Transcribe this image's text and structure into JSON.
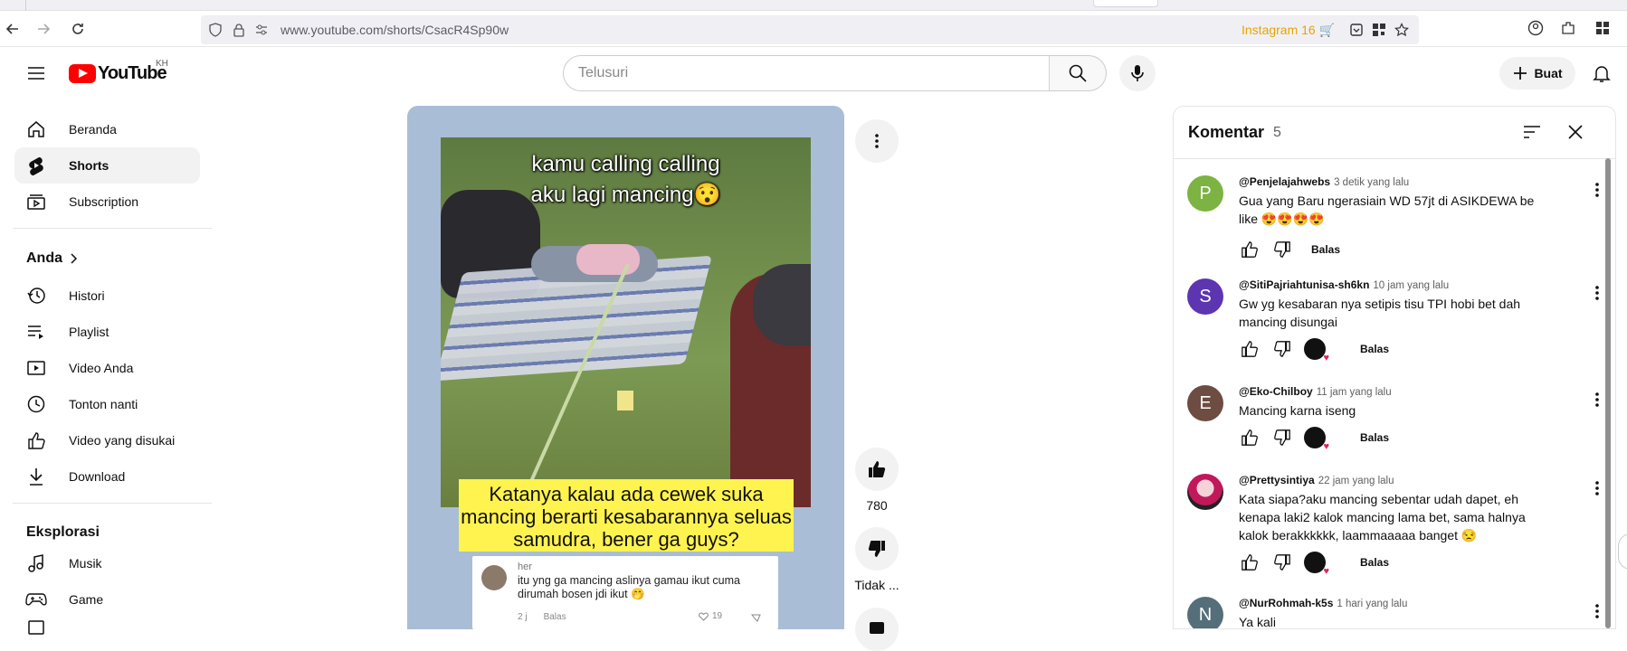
{
  "browser": {
    "url": "www.youtube.com/shorts/CsacR4Sp90w",
    "extension_label": "Instagram 16 🛒"
  },
  "header": {
    "logo_text": "YouTube",
    "country_code": "KH",
    "search_placeholder": "Telusuri",
    "create_label": "Buat"
  },
  "sidebar": {
    "main": [
      {
        "label": "Beranda",
        "icon": "home-icon"
      },
      {
        "label": "Shorts",
        "icon": "shorts-icon"
      },
      {
        "label": "Subscription",
        "icon": "subscriptions-icon"
      }
    ],
    "you_heading": "Anda",
    "you": [
      {
        "label": "Histori",
        "icon": "history-icon"
      },
      {
        "label": "Playlist",
        "icon": "playlist-icon"
      },
      {
        "label": "Video Anda",
        "icon": "your-videos-icon"
      },
      {
        "label": "Tonton nanti",
        "icon": "watch-later-icon"
      },
      {
        "label": "Video yang disukai",
        "icon": "liked-icon"
      },
      {
        "label": "Download",
        "icon": "download-icon"
      }
    ],
    "explore_heading": "Eksplorasi",
    "explore": [
      {
        "label": "Musik",
        "icon": "music-icon"
      },
      {
        "label": "Game",
        "icon": "gaming-icon"
      }
    ]
  },
  "video": {
    "overlay_line1": "kamu calling calling",
    "overlay_line2": "aku lagi mancing😯",
    "caption": "Katanya kalau ada cewek suka mancing berarti kesabarannya seluas samudra, bener ga guys?",
    "inner_comment": {
      "name": "her",
      "text": "itu yng ga mancing aslinya gamau ikut cuma dirumah bosen jdi ikut 🤭",
      "time": "2 j",
      "reply": "Balas",
      "likes": "19"
    }
  },
  "actions": {
    "like_count": "780",
    "dislike_label": "Tidak ..."
  },
  "comments": {
    "title": "Komentar",
    "count": "5",
    "reply_label": "Balas",
    "items": [
      {
        "author": "@Penjelajahwebs",
        "time": "3 detik yang lalu",
        "text": "Gua yang Baru ngerasiain WD 57jt di ASIKDEWA be like 😍😍😍😍",
        "initial": "P",
        "color": "#7cb342"
      },
      {
        "author": "@SitiPajriahtunisa-sh6kn",
        "time": "10 jam yang lalu",
        "text": "Gw yg kesabaran nya setipis tisu TPI hobi bet dah mancing disungai",
        "initial": "S",
        "color": "#5e35b1"
      },
      {
        "author": "@Eko-Chilboy",
        "time": "11 jam yang lalu",
        "text": "Mancing karna iseng",
        "initial": "E",
        "color": "#6d4c41"
      },
      {
        "author": "@Prettysintiya",
        "time": "22 jam yang lalu",
        "text": "Kata siapa?aku mancing sebentar udah dapet, eh kenapa laki2 kalok mancing lama bet, sama halnya kalok berakkkkkk, laammaaaaa banget 😒",
        "initial": "",
        "color": "#c2185b"
      },
      {
        "author": "@NurRohmah-k5s",
        "time": "1 hari yang lalu",
        "text": "Ya kali",
        "initial": "N",
        "color": "#546e7a"
      }
    ]
  }
}
